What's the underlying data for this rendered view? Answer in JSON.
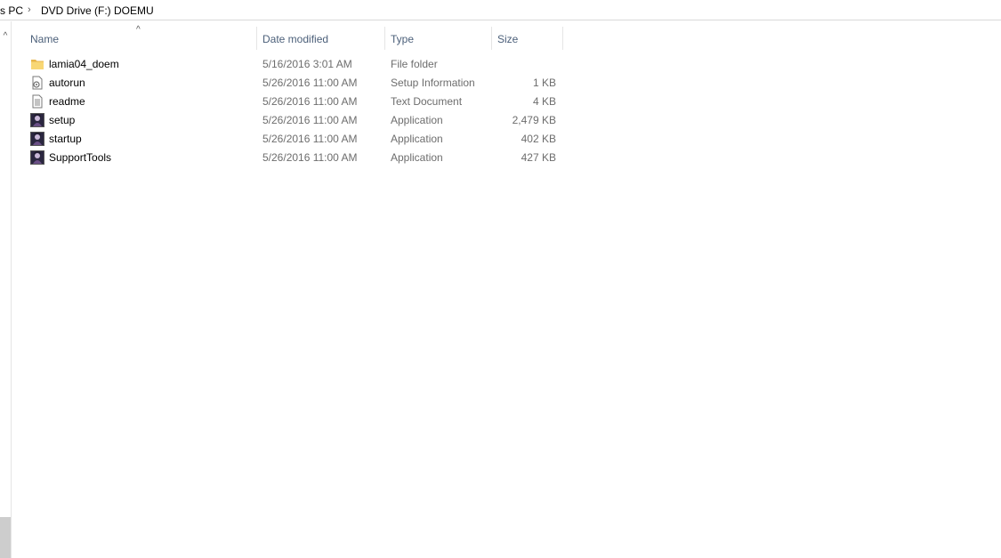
{
  "address_bar": {
    "crumbs": [
      "s PC",
      "DVD Drive (F:) DOEMU"
    ],
    "separator": "›"
  },
  "nav_pane": {
    "scroll_up_glyph": "^"
  },
  "columns": {
    "name": "Name",
    "date_modified": "Date modified",
    "type": "Type",
    "size": "Size",
    "sort_indicator": "^"
  },
  "files": [
    {
      "name": "lamia04_doem",
      "date": "5/16/2016 3:01 AM",
      "type": "File folder",
      "size": "",
      "icon": "folder-icon"
    },
    {
      "name": "autorun",
      "date": "5/26/2016 11:00 AM",
      "type": "Setup Information",
      "size": "1 KB",
      "icon": "setup-info-icon"
    },
    {
      "name": "readme",
      "date": "5/26/2016 11:00 AM",
      "type": "Text Document",
      "size": "4 KB",
      "icon": "text-document-icon"
    },
    {
      "name": "setup",
      "date": "5/26/2016 11:00 AM",
      "type": "Application",
      "size": "2,479 KB",
      "icon": "application-icon"
    },
    {
      "name": "startup",
      "date": "5/26/2016 11:00 AM",
      "type": "Application",
      "size": "402 KB",
      "icon": "application-icon"
    },
    {
      "name": "SupportTools",
      "date": "5/26/2016 11:00 AM",
      "type": "Application",
      "size": "427 KB",
      "icon": "application-icon"
    }
  ],
  "colors": {
    "header_text": "#4c607a",
    "secondary_text": "#6d6d6d",
    "folder": "#f8d775"
  }
}
